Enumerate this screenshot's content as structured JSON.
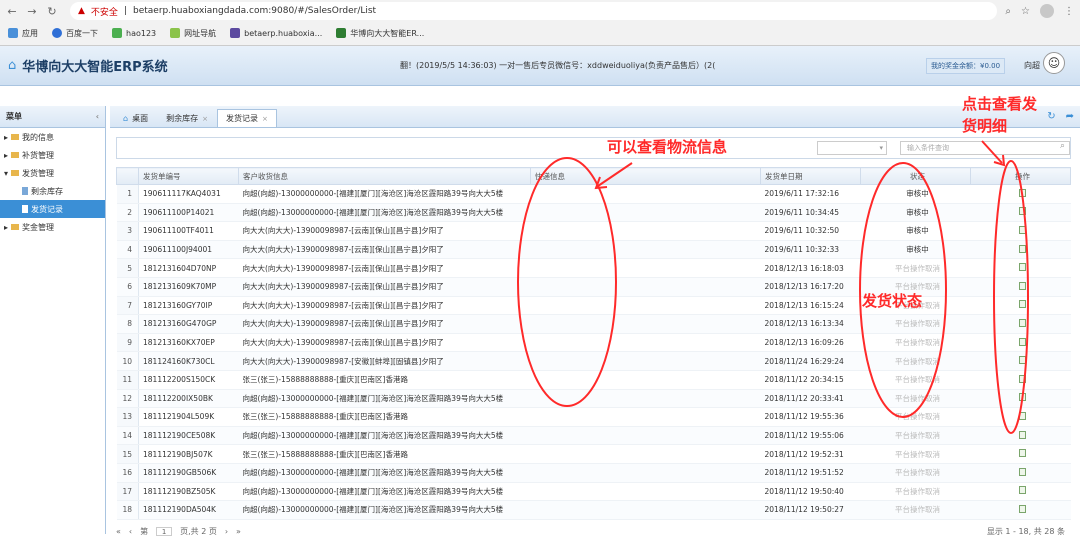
{
  "browser": {
    "insecure_label": "不安全",
    "url": "betaerp.huaboxiangdada.com:9080/#/SalesOrder/List",
    "bookmarks": [
      "应用",
      "百度一下",
      "hao123",
      "网址导航",
      "betaerp.huaboxia...",
      "华博向大大智能ER..."
    ]
  },
  "app": {
    "title": "华博向大大智能ERP系统",
    "marquee": "翻！(2019/5/5 14:36:03) 一对一售后专员微信号：xddweiduoliya(负责产品售后）(2(",
    "bonus": "我的奖金余额：¥0.00",
    "user": "向超"
  },
  "sidebar": {
    "header": "菜单",
    "items": [
      {
        "label": "我的信息"
      },
      {
        "label": "补货管理"
      },
      {
        "label": "发货管理"
      },
      {
        "label": "剩余库存"
      },
      {
        "label": "发货记录"
      },
      {
        "label": "奖金管理"
      }
    ]
  },
  "tabs": [
    {
      "label": "桌面"
    },
    {
      "label": "剩余库存"
    },
    {
      "label": "发货记录"
    }
  ],
  "search": {
    "placeholder": "输入条件查询"
  },
  "table": {
    "headers": [
      "发货单编号",
      "客户收货信息",
      "快递信息",
      "发货单日期",
      "状态",
      "操作"
    ],
    "rows": [
      {
        "n": "1",
        "id": "190611117KAQ4031",
        "addr": "向超(向超)-13000000000-[福建][厦门][海沧区]海沧区霞阳路39号向大大5楼",
        "date": "2019/6/11 17:32:16",
        "status": "审核中"
      },
      {
        "n": "2",
        "id": "190611100P14021",
        "addr": "向超(向超)-13000000000-[福建][厦门][海沧区]海沧区霞阳路39号向大大5楼",
        "date": "2019/6/11 10:34:45",
        "status": "审核中"
      },
      {
        "n": "3",
        "id": "190611100TF4011",
        "addr": "向大大(向大大)-13900098987-[云南][保山][昌宁县]夕阳了",
        "date": "2019/6/11 10:32:50",
        "status": "审核中"
      },
      {
        "n": "4",
        "id": "190611100J94001",
        "addr": "向大大(向大大)-13900098987-[云南][保山][昌宁县]夕阳了",
        "date": "2019/6/11 10:32:33",
        "status": "审核中"
      },
      {
        "n": "5",
        "id": "1812131604D70NP",
        "addr": "向大大(向大大)-13900098987-[云南][保山][昌宁县]夕阳了",
        "date": "2018/12/13 16:18:03",
        "status": "平台操作取消"
      },
      {
        "n": "6",
        "id": "1812131609K70MP",
        "addr": "向大大(向大大)-13900098987-[云南][保山][昌宁县]夕阳了",
        "date": "2018/12/13 16:17:20",
        "status": "平台操作取消"
      },
      {
        "n": "7",
        "id": "181213160GY70IP",
        "addr": "向大大(向大大)-13900098987-[云南][保山][昌宁县]夕阳了",
        "date": "2018/12/13 16:15:24",
        "status": "平台操作取消"
      },
      {
        "n": "8",
        "id": "181213160G470GP",
        "addr": "向大大(向大大)-13900098987-[云南][保山][昌宁县]夕阳了",
        "date": "2018/12/13 16:13:34",
        "status": "平台操作取消"
      },
      {
        "n": "9",
        "id": "181213160KX70EP",
        "addr": "向大大(向大大)-13900098987-[云南][保山][昌宁县]夕阳了",
        "date": "2018/12/13 16:09:26",
        "status": "平台操作取消"
      },
      {
        "n": "10",
        "id": "181124160K730CL",
        "addr": "向大大(向大大)-13900098987-[安徽][蚌埠][固镇县]夕阳了",
        "date": "2018/11/24 16:29:24",
        "status": "平台操作取消"
      },
      {
        "n": "11",
        "id": "181112200S150CK",
        "addr": "张三(张三)-15888888888-[重庆][巴南区]香港路",
        "date": "2018/11/12 20:34:15",
        "status": "平台操作取消"
      },
      {
        "n": "12",
        "id": "181112200IX50BK",
        "addr": "向超(向超)-13000000000-[福建][厦门][海沧区]海沧区霞阳路39号向大大5楼",
        "date": "2018/11/12 20:33:41",
        "status": "平台操作取消"
      },
      {
        "n": "13",
        "id": "1811121904L509K",
        "addr": "张三(张三)-15888888888-[重庆][巴南区]香港路",
        "date": "2018/11/12 19:55:36",
        "status": "平台操作取消"
      },
      {
        "n": "14",
        "id": "181112190CE508K",
        "addr": "向超(向超)-13000000000-[福建][厦门][海沧区]海沧区霞阳路39号向大大5楼",
        "date": "2018/11/12 19:55:06",
        "status": "平台操作取消"
      },
      {
        "n": "15",
        "id": "181112190BJ507K",
        "addr": "张三(张三)-15888888888-[重庆][巴南区]香港路",
        "date": "2018/11/12 19:52:31",
        "status": "平台操作取消"
      },
      {
        "n": "16",
        "id": "181112190GB506K",
        "addr": "向超(向超)-13000000000-[福建][厦门][海沧区]海沧区霞阳路39号向大大5楼",
        "date": "2018/11/12 19:51:52",
        "status": "平台操作取消"
      },
      {
        "n": "17",
        "id": "181112190BZ505K",
        "addr": "向超(向超)-13000000000-[福建][厦门][海沧区]海沧区霞阳路39号向大大5楼",
        "date": "2018/11/12 19:50:40",
        "status": "平台操作取消"
      },
      {
        "n": "18",
        "id": "181112190DA504K",
        "addr": "向超(向超)-13000000000-[福建][厦门][海沧区]海沧区霞阳路39号向大大5楼",
        "date": "2018/11/12 19:50:27",
        "status": "平台操作取消"
      }
    ]
  },
  "pager": {
    "page_label": "第",
    "page": "1",
    "of_label": "页,共 2 页",
    "info": "显示 1 - 18, 共 28 条"
  },
  "annotations": {
    "logistics": "可以查看物流信息",
    "status": "发货状态",
    "detail_line1": "点击查看发",
    "detail_line2": "货明细"
  },
  "colors": {
    "annotation": "#ff2a2a",
    "accent": "#3b8fd6"
  }
}
